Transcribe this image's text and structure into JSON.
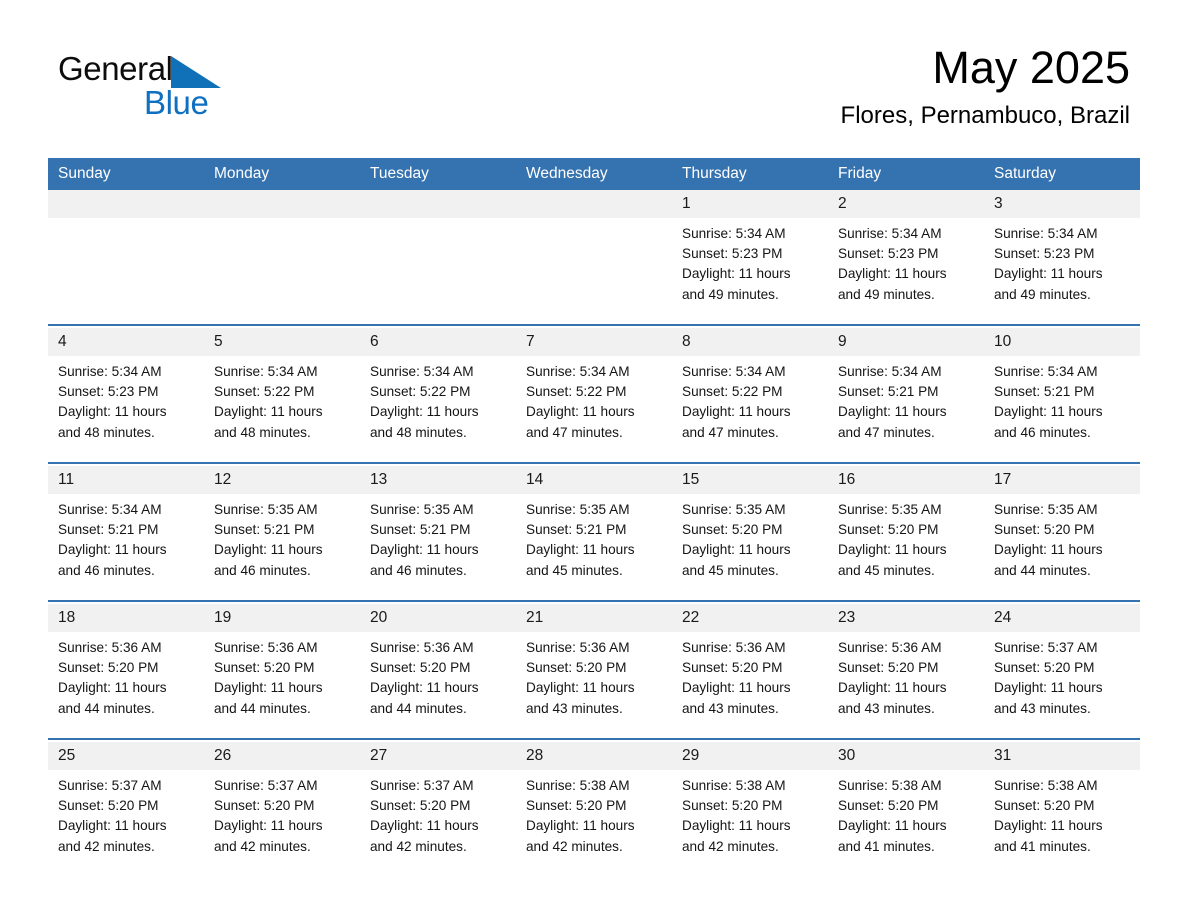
{
  "brand": {
    "name_part1": "General",
    "name_part2": "Blue",
    "triangle_color": "#1071b8",
    "blue_text_color": "#0f6fc0"
  },
  "header": {
    "month_title": "May 2025",
    "location": "Flores, Pernambuco, Brazil"
  },
  "colors": {
    "header_blue": "#3572b0",
    "daynum_bg": "#f1f1f1",
    "separator_blue": "#3572b0",
    "text": "#000000"
  },
  "weekday_headers": [
    "Sunday",
    "Monday",
    "Tuesday",
    "Wednesday",
    "Thursday",
    "Friday",
    "Saturday"
  ],
  "weeks": [
    {
      "days": [
        {
          "num": "",
          "sunrise": "",
          "sunset": "",
          "daylight_line1": "",
          "daylight_line2": ""
        },
        {
          "num": "",
          "sunrise": "",
          "sunset": "",
          "daylight_line1": "",
          "daylight_line2": ""
        },
        {
          "num": "",
          "sunrise": "",
          "sunset": "",
          "daylight_line1": "",
          "daylight_line2": ""
        },
        {
          "num": "",
          "sunrise": "",
          "sunset": "",
          "daylight_line1": "",
          "daylight_line2": ""
        },
        {
          "num": "1",
          "sunrise": "Sunrise: 5:34 AM",
          "sunset": "Sunset: 5:23 PM",
          "daylight_line1": "Daylight: 11 hours",
          "daylight_line2": "and 49 minutes."
        },
        {
          "num": "2",
          "sunrise": "Sunrise: 5:34 AM",
          "sunset": "Sunset: 5:23 PM",
          "daylight_line1": "Daylight: 11 hours",
          "daylight_line2": "and 49 minutes."
        },
        {
          "num": "3",
          "sunrise": "Sunrise: 5:34 AM",
          "sunset": "Sunset: 5:23 PM",
          "daylight_line1": "Daylight: 11 hours",
          "daylight_line2": "and 49 minutes."
        }
      ]
    },
    {
      "days": [
        {
          "num": "4",
          "sunrise": "Sunrise: 5:34 AM",
          "sunset": "Sunset: 5:23 PM",
          "daylight_line1": "Daylight: 11 hours",
          "daylight_line2": "and 48 minutes."
        },
        {
          "num": "5",
          "sunrise": "Sunrise: 5:34 AM",
          "sunset": "Sunset: 5:22 PM",
          "daylight_line1": "Daylight: 11 hours",
          "daylight_line2": "and 48 minutes."
        },
        {
          "num": "6",
          "sunrise": "Sunrise: 5:34 AM",
          "sunset": "Sunset: 5:22 PM",
          "daylight_line1": "Daylight: 11 hours",
          "daylight_line2": "and 48 minutes."
        },
        {
          "num": "7",
          "sunrise": "Sunrise: 5:34 AM",
          "sunset": "Sunset: 5:22 PM",
          "daylight_line1": "Daylight: 11 hours",
          "daylight_line2": "and 47 minutes."
        },
        {
          "num": "8",
          "sunrise": "Sunrise: 5:34 AM",
          "sunset": "Sunset: 5:22 PM",
          "daylight_line1": "Daylight: 11 hours",
          "daylight_line2": "and 47 minutes."
        },
        {
          "num": "9",
          "sunrise": "Sunrise: 5:34 AM",
          "sunset": "Sunset: 5:21 PM",
          "daylight_line1": "Daylight: 11 hours",
          "daylight_line2": "and 47 minutes."
        },
        {
          "num": "10",
          "sunrise": "Sunrise: 5:34 AM",
          "sunset": "Sunset: 5:21 PM",
          "daylight_line1": "Daylight: 11 hours",
          "daylight_line2": "and 46 minutes."
        }
      ]
    },
    {
      "days": [
        {
          "num": "11",
          "sunrise": "Sunrise: 5:34 AM",
          "sunset": "Sunset: 5:21 PM",
          "daylight_line1": "Daylight: 11 hours",
          "daylight_line2": "and 46 minutes."
        },
        {
          "num": "12",
          "sunrise": "Sunrise: 5:35 AM",
          "sunset": "Sunset: 5:21 PM",
          "daylight_line1": "Daylight: 11 hours",
          "daylight_line2": "and 46 minutes."
        },
        {
          "num": "13",
          "sunrise": "Sunrise: 5:35 AM",
          "sunset": "Sunset: 5:21 PM",
          "daylight_line1": "Daylight: 11 hours",
          "daylight_line2": "and 46 minutes."
        },
        {
          "num": "14",
          "sunrise": "Sunrise: 5:35 AM",
          "sunset": "Sunset: 5:21 PM",
          "daylight_line1": "Daylight: 11 hours",
          "daylight_line2": "and 45 minutes."
        },
        {
          "num": "15",
          "sunrise": "Sunrise: 5:35 AM",
          "sunset": "Sunset: 5:20 PM",
          "daylight_line1": "Daylight: 11 hours",
          "daylight_line2": "and 45 minutes."
        },
        {
          "num": "16",
          "sunrise": "Sunrise: 5:35 AM",
          "sunset": "Sunset: 5:20 PM",
          "daylight_line1": "Daylight: 11 hours",
          "daylight_line2": "and 45 minutes."
        },
        {
          "num": "17",
          "sunrise": "Sunrise: 5:35 AM",
          "sunset": "Sunset: 5:20 PM",
          "daylight_line1": "Daylight: 11 hours",
          "daylight_line2": "and 44 minutes."
        }
      ]
    },
    {
      "days": [
        {
          "num": "18",
          "sunrise": "Sunrise: 5:36 AM",
          "sunset": "Sunset: 5:20 PM",
          "daylight_line1": "Daylight: 11 hours",
          "daylight_line2": "and 44 minutes."
        },
        {
          "num": "19",
          "sunrise": "Sunrise: 5:36 AM",
          "sunset": "Sunset: 5:20 PM",
          "daylight_line1": "Daylight: 11 hours",
          "daylight_line2": "and 44 minutes."
        },
        {
          "num": "20",
          "sunrise": "Sunrise: 5:36 AM",
          "sunset": "Sunset: 5:20 PM",
          "daylight_line1": "Daylight: 11 hours",
          "daylight_line2": "and 44 minutes."
        },
        {
          "num": "21",
          "sunrise": "Sunrise: 5:36 AM",
          "sunset": "Sunset: 5:20 PM",
          "daylight_line1": "Daylight: 11 hours",
          "daylight_line2": "and 43 minutes."
        },
        {
          "num": "22",
          "sunrise": "Sunrise: 5:36 AM",
          "sunset": "Sunset: 5:20 PM",
          "daylight_line1": "Daylight: 11 hours",
          "daylight_line2": "and 43 minutes."
        },
        {
          "num": "23",
          "sunrise": "Sunrise: 5:36 AM",
          "sunset": "Sunset: 5:20 PM",
          "daylight_line1": "Daylight: 11 hours",
          "daylight_line2": "and 43 minutes."
        },
        {
          "num": "24",
          "sunrise": "Sunrise: 5:37 AM",
          "sunset": "Sunset: 5:20 PM",
          "daylight_line1": "Daylight: 11 hours",
          "daylight_line2": "and 43 minutes."
        }
      ]
    },
    {
      "days": [
        {
          "num": "25",
          "sunrise": "Sunrise: 5:37 AM",
          "sunset": "Sunset: 5:20 PM",
          "daylight_line1": "Daylight: 11 hours",
          "daylight_line2": "and 42 minutes."
        },
        {
          "num": "26",
          "sunrise": "Sunrise: 5:37 AM",
          "sunset": "Sunset: 5:20 PM",
          "daylight_line1": "Daylight: 11 hours",
          "daylight_line2": "and 42 minutes."
        },
        {
          "num": "27",
          "sunrise": "Sunrise: 5:37 AM",
          "sunset": "Sunset: 5:20 PM",
          "daylight_line1": "Daylight: 11 hours",
          "daylight_line2": "and 42 minutes."
        },
        {
          "num": "28",
          "sunrise": "Sunrise: 5:38 AM",
          "sunset": "Sunset: 5:20 PM",
          "daylight_line1": "Daylight: 11 hours",
          "daylight_line2": "and 42 minutes."
        },
        {
          "num": "29",
          "sunrise": "Sunrise: 5:38 AM",
          "sunset": "Sunset: 5:20 PM",
          "daylight_line1": "Daylight: 11 hours",
          "daylight_line2": "and 42 minutes."
        },
        {
          "num": "30",
          "sunrise": "Sunrise: 5:38 AM",
          "sunset": "Sunset: 5:20 PM",
          "daylight_line1": "Daylight: 11 hours",
          "daylight_line2": "and 41 minutes."
        },
        {
          "num": "31",
          "sunrise": "Sunrise: 5:38 AM",
          "sunset": "Sunset: 5:20 PM",
          "daylight_line1": "Daylight: 11 hours",
          "daylight_line2": "and 41 minutes."
        }
      ]
    }
  ]
}
